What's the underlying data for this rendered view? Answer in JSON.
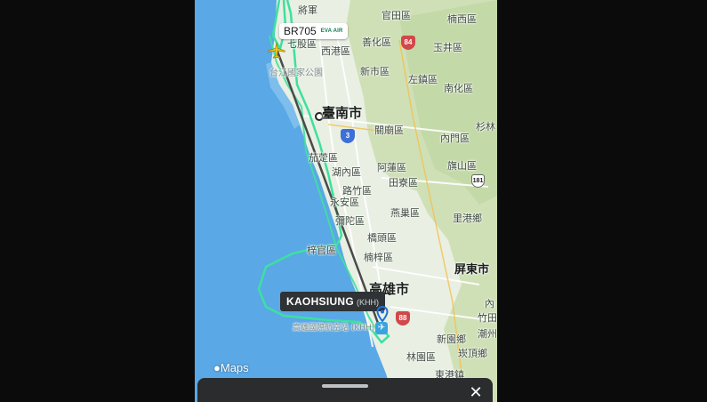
{
  "flight": {
    "number": "BR705",
    "airline_logo": "EVA AIR",
    "aircraft_icon": "airplane-icon"
  },
  "airport": {
    "name": "KAOHSIUNG",
    "code": "(KHH)",
    "pin_icon": "location-pin-icon",
    "airport_icon": "airport-icon"
  },
  "map": {
    "cities": {
      "tainan": "臺南市",
      "kaohsiung": "高雄市",
      "pingtung": "屏東市"
    },
    "districts": {
      "jiangjun": "將軍",
      "guantian": "官田區",
      "nanxi": "楠西區",
      "qigu": "七股區",
      "shanhua": "善化區",
      "yujing": "玉井區",
      "xigang": "西港區",
      "xinshi": "新市區",
      "zuozhen": "左鎮區",
      "nanhua": "南化區",
      "taijiang_park": "台江國家公園",
      "guanmiao": "關廟區",
      "shanlin": "杉林",
      "neimen": "內門區",
      "qieding": "茄萣區",
      "qishan": "旗山區",
      "hunei": "湖內區",
      "alian": "阿蓮區",
      "luzhu": "路竹區",
      "tianliao": "田寮區",
      "yongan": "永安區",
      "yanchao": "燕巢區",
      "ligang": "里港鄉",
      "mituo": "彌陀區",
      "qiaotou": "橋頭區",
      "ziguan": "梓官區",
      "nanzi": "楠梓區",
      "nei": "內",
      "zhutian": "竹田",
      "chaozhou": "潮州",
      "xinyuan": "新園鄉",
      "kanding": "崁頂鄉",
      "linyuan": "林園區",
      "donggang": "東港鎮",
      "airport_cn": "高雄國際航空站 (KHH)"
    },
    "shields": {
      "h84_top": "84",
      "h3": "3",
      "h181": "181",
      "h88": "88"
    }
  },
  "brand": {
    "apple_icon": "apple-icon",
    "label": "Maps"
  },
  "sheet": {
    "grabber": "sheet-grabber",
    "close_icon": "close-icon",
    "close_glyph": "✕"
  },
  "colors": {
    "sea": "#5aa8e6",
    "land": "#e9efe2",
    "hills": "#cfe0b6",
    "track": "#3ee0a0",
    "route": "#4a4a4a"
  }
}
